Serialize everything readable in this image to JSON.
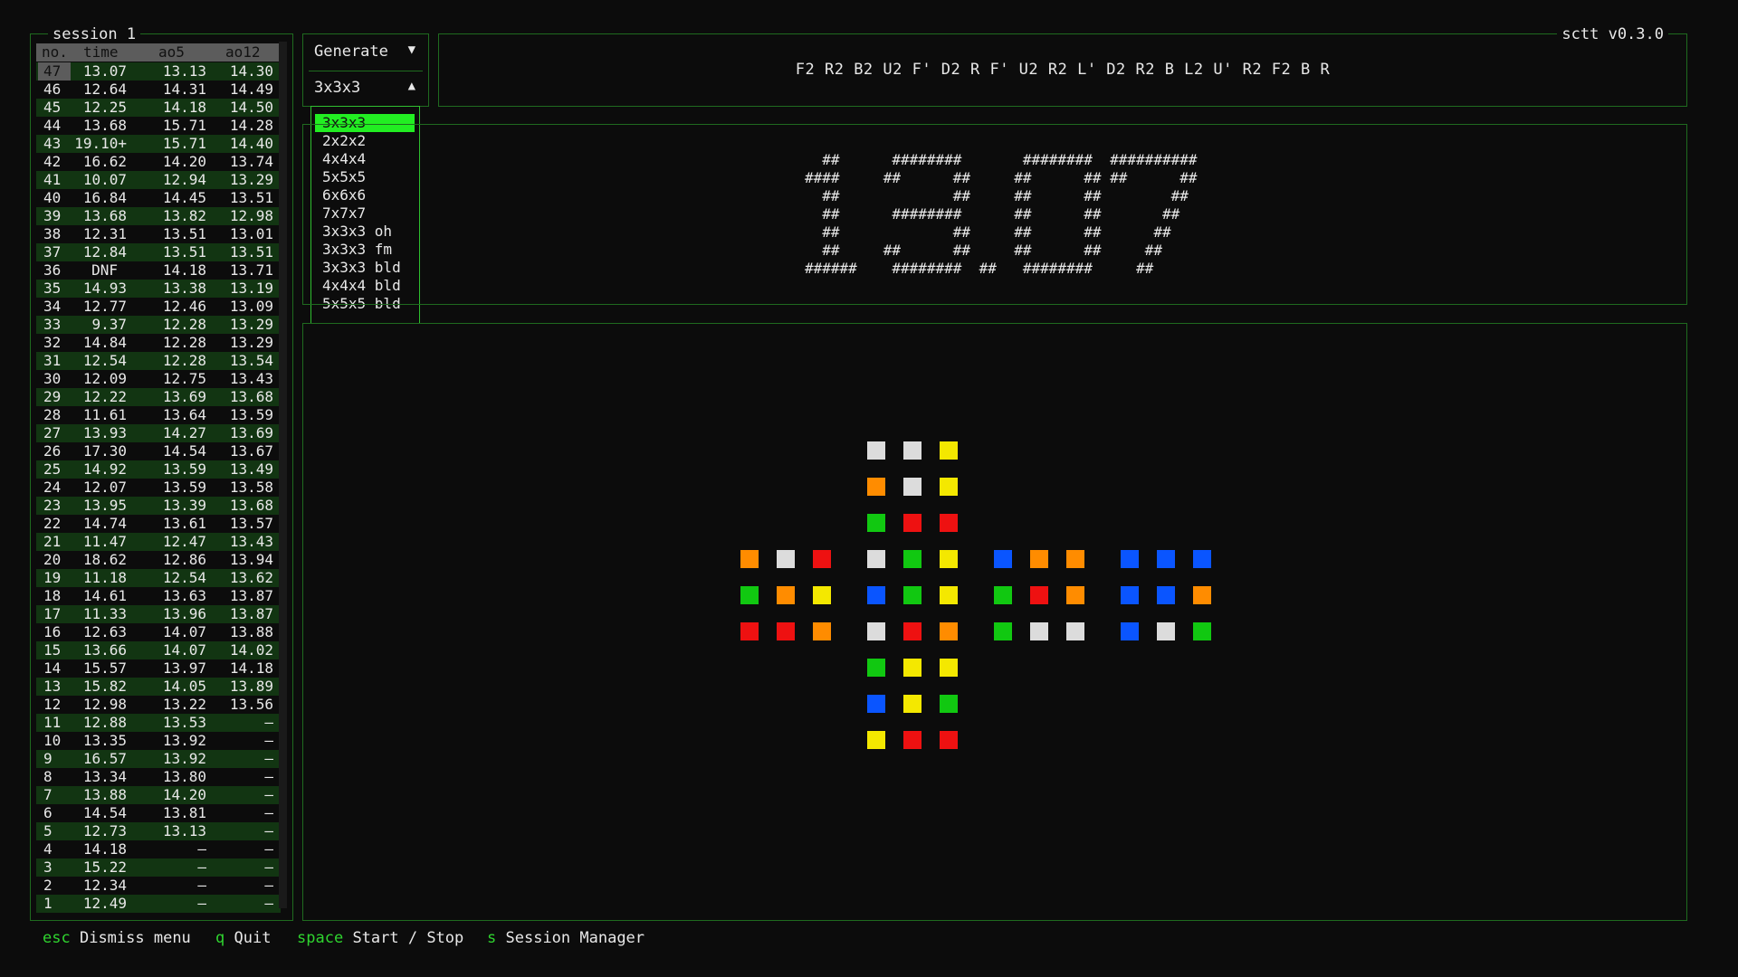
{
  "app": {
    "version": "sctt v0.3.0"
  },
  "session": {
    "title": "session 1",
    "columns": [
      "no.",
      "time",
      "ao5",
      "ao12"
    ],
    "rows": [
      {
        "no": "47",
        "time": "13.07",
        "ao5": "13.13",
        "ao12": "14.30"
      },
      {
        "no": "46",
        "time": "12.64",
        "ao5": "14.31",
        "ao12": "14.49"
      },
      {
        "no": "45",
        "time": "12.25",
        "ao5": "14.18",
        "ao12": "14.50"
      },
      {
        "no": "44",
        "time": "13.68",
        "ao5": "15.71",
        "ao12": "14.28"
      },
      {
        "no": "43",
        "time": "19.10+",
        "ao5": "15.71",
        "ao12": "14.40"
      },
      {
        "no": "42",
        "time": "16.62",
        "ao5": "14.20",
        "ao12": "13.74"
      },
      {
        "no": "41",
        "time": "10.07",
        "ao5": "12.94",
        "ao12": "13.29"
      },
      {
        "no": "40",
        "time": "16.84",
        "ao5": "14.45",
        "ao12": "13.51"
      },
      {
        "no": "39",
        "time": "13.68",
        "ao5": "13.82",
        "ao12": "12.98"
      },
      {
        "no": "38",
        "time": "12.31",
        "ao5": "13.51",
        "ao12": "13.01"
      },
      {
        "no": "37",
        "time": "12.84",
        "ao5": "13.51",
        "ao12": "13.51"
      },
      {
        "no": "36",
        "time": "DNF",
        "ao5": "14.18",
        "ao12": "13.71"
      },
      {
        "no": "35",
        "time": "14.93",
        "ao5": "13.38",
        "ao12": "13.19"
      },
      {
        "no": "34",
        "time": "12.77",
        "ao5": "12.46",
        "ao12": "13.09"
      },
      {
        "no": "33",
        "time": "9.37",
        "ao5": "12.28",
        "ao12": "13.29"
      },
      {
        "no": "32",
        "time": "14.84",
        "ao5": "12.28",
        "ao12": "13.29"
      },
      {
        "no": "31",
        "time": "12.54",
        "ao5": "12.28",
        "ao12": "13.54"
      },
      {
        "no": "30",
        "time": "12.09",
        "ao5": "12.75",
        "ao12": "13.43"
      },
      {
        "no": "29",
        "time": "12.22",
        "ao5": "13.69",
        "ao12": "13.68"
      },
      {
        "no": "28",
        "time": "11.61",
        "ao5": "13.64",
        "ao12": "13.59"
      },
      {
        "no": "27",
        "time": "13.93",
        "ao5": "14.27",
        "ao12": "13.69"
      },
      {
        "no": "26",
        "time": "17.30",
        "ao5": "14.54",
        "ao12": "13.67"
      },
      {
        "no": "25",
        "time": "14.92",
        "ao5": "13.59",
        "ao12": "13.49"
      },
      {
        "no": "24",
        "time": "12.07",
        "ao5": "13.59",
        "ao12": "13.58"
      },
      {
        "no": "23",
        "time": "13.95",
        "ao5": "13.39",
        "ao12": "13.68"
      },
      {
        "no": "22",
        "time": "14.74",
        "ao5": "13.61",
        "ao12": "13.57"
      },
      {
        "no": "21",
        "time": "11.47",
        "ao5": "12.47",
        "ao12": "13.43"
      },
      {
        "no": "20",
        "time": "18.62",
        "ao5": "12.86",
        "ao12": "13.94"
      },
      {
        "no": "19",
        "time": "11.18",
        "ao5": "12.54",
        "ao12": "13.62"
      },
      {
        "no": "18",
        "time": "14.61",
        "ao5": "13.63",
        "ao12": "13.87"
      },
      {
        "no": "17",
        "time": "11.33",
        "ao5": "13.96",
        "ao12": "13.87"
      },
      {
        "no": "16",
        "time": "12.63",
        "ao5": "14.07",
        "ao12": "13.88"
      },
      {
        "no": "15",
        "time": "13.66",
        "ao5": "14.07",
        "ao12": "14.02"
      },
      {
        "no": "14",
        "time": "15.57",
        "ao5": "13.97",
        "ao12": "14.18"
      },
      {
        "no": "13",
        "time": "15.82",
        "ao5": "14.05",
        "ao12": "13.89"
      },
      {
        "no": "12",
        "time": "12.98",
        "ao5": "13.22",
        "ao12": "13.56"
      },
      {
        "no": "11",
        "time": "12.88",
        "ao5": "13.53",
        "ao12": "–"
      },
      {
        "no": "10",
        "time": "13.35",
        "ao5": "13.92",
        "ao12": "–"
      },
      {
        "no": "9",
        "time": "16.57",
        "ao5": "13.92",
        "ao12": "–"
      },
      {
        "no": "8",
        "time": "13.34",
        "ao5": "13.80",
        "ao12": "–"
      },
      {
        "no": "7",
        "time": "13.88",
        "ao5": "14.20",
        "ao12": "–"
      },
      {
        "no": "6",
        "time": "14.54",
        "ao5": "13.81",
        "ao12": "–"
      },
      {
        "no": "5",
        "time": "12.73",
        "ao5": "13.13",
        "ao12": "–"
      },
      {
        "no": "4",
        "time": "14.18",
        "ao5": "–",
        "ao12": "–"
      },
      {
        "no": "3",
        "time": "15.22",
        "ao5": "–",
        "ao12": "–"
      },
      {
        "no": "2",
        "time": "12.34",
        "ao5": "–",
        "ao12": "–"
      },
      {
        "no": "1",
        "time": "12.49",
        "ao5": "–",
        "ao12": "–"
      }
    ]
  },
  "generator": {
    "label": "Generate",
    "arrow": "▼",
    "puzzle": "3x3x3",
    "puzzle_arrow": "▲",
    "options": [
      "3x3x3",
      "2x2x2",
      "4x4x4",
      "5x5x5",
      "6x6x6",
      "7x7x7",
      "3x3x3 oh",
      "3x3x3 fm",
      "3x3x3 bld",
      "4x4x4 bld",
      "5x5x5 bld"
    ],
    "selected_index": 0
  },
  "scramble": "F2 R2 B2 U2 F' D2 R F' U2 R2 L' D2 R2 B L2 U' R2 F2 B R",
  "timer": {
    "display": "13.07",
    "art": "  ##      ########       ########  ##########\n####     ##      ##     ##      ## ##      ##\n  ##             ##     ##      ##        ##\n  ##      ########      ##      ##       ##\n  ##             ##     ##      ##      ##\n  ##     ##      ##     ##      ##     ##\n######    ########  ##   ########     ##"
  },
  "colors": {
    "W": "#dcdcdc",
    "Y": "#f4e800",
    "R": "#ee1111",
    "O": "#ff8c00",
    "G": "#11c811",
    "B": "#0a55ff"
  },
  "cube_net": {
    "U": [
      "WWY",
      "OWY",
      "GRR"
    ],
    "L": [
      "OWR",
      "GOY",
      "RRO"
    ],
    "F": [
      "WGY",
      "BGY",
      "WRO"
    ],
    "R": [
      "BOO",
      "GRO",
      "GWW"
    ],
    "B": [
      "BBB",
      "BBO",
      "BWG"
    ],
    "D": [
      "GYY",
      "BYG",
      "YRR"
    ]
  },
  "footer": [
    {
      "key": "esc",
      "label": "Dismiss menu"
    },
    {
      "key": "q",
      "label": "Quit"
    },
    {
      "key": "space",
      "label": "Start / Stop"
    },
    {
      "key": "s",
      "label": "Session Manager"
    }
  ]
}
